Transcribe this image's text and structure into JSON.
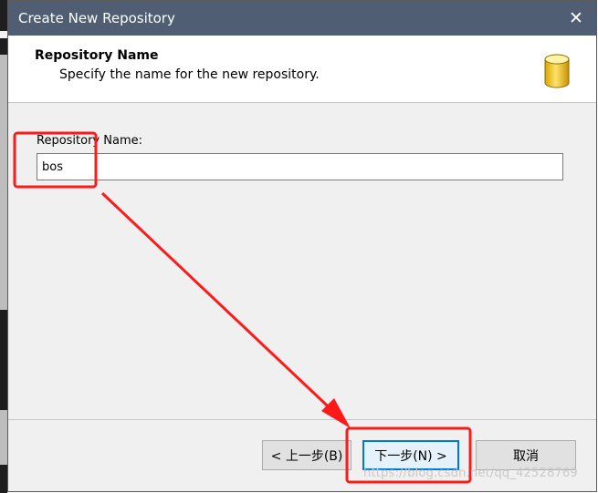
{
  "window": {
    "title": "Create New Repository",
    "close_glyph": "✕"
  },
  "header": {
    "title": "Repository Name",
    "subtitle": "Specify the name for the new repository.",
    "icon": "database-cylinder-icon"
  },
  "form": {
    "label": "Repository Name:",
    "value": "bos"
  },
  "buttons": {
    "back": "< 上一步(B)",
    "next": "下一步(N) >",
    "cancel": "取消"
  },
  "annotation": {
    "color": "#ff1a1a"
  },
  "watermark": "https://blog.csdn.net/qq_42528769"
}
